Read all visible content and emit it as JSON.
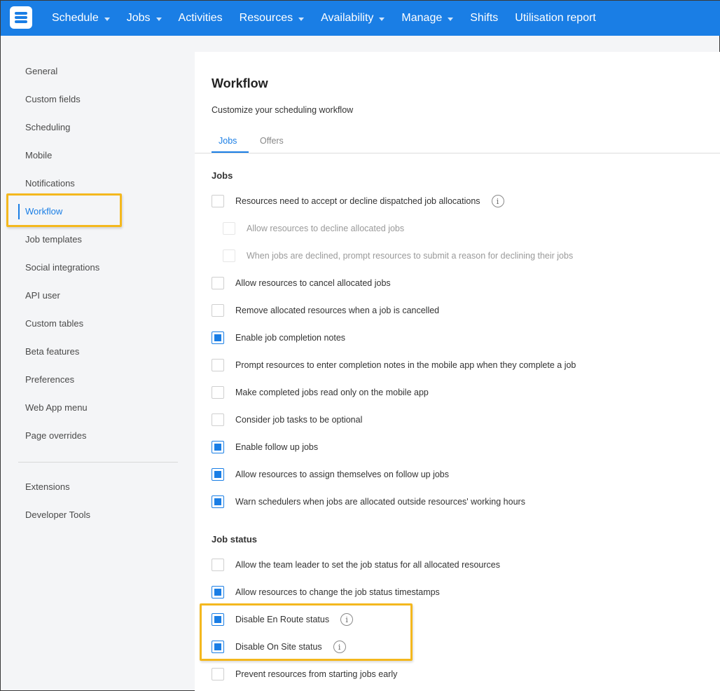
{
  "nav": {
    "items": [
      {
        "label": "Schedule",
        "dropdown": true
      },
      {
        "label": "Jobs",
        "dropdown": true
      },
      {
        "label": "Activities",
        "dropdown": false
      },
      {
        "label": "Resources",
        "dropdown": true
      },
      {
        "label": "Availability",
        "dropdown": true
      },
      {
        "label": "Manage",
        "dropdown": true
      },
      {
        "label": "Shifts",
        "dropdown": false
      },
      {
        "label": "Utilisation report",
        "dropdown": false
      }
    ]
  },
  "sidebar": {
    "items": [
      {
        "label": "General"
      },
      {
        "label": "Custom fields"
      },
      {
        "label": "Scheduling"
      },
      {
        "label": "Mobile"
      },
      {
        "label": "Notifications"
      },
      {
        "label": "Workflow",
        "active": true
      },
      {
        "label": "Job templates"
      },
      {
        "label": "Social integrations"
      },
      {
        "label": "API user"
      },
      {
        "label": "Custom tables"
      },
      {
        "label": "Beta features"
      },
      {
        "label": "Preferences"
      },
      {
        "label": "Web App menu"
      },
      {
        "label": "Page overrides"
      }
    ],
    "secondary": [
      {
        "label": "Extensions"
      },
      {
        "label": "Developer Tools"
      }
    ]
  },
  "main": {
    "title": "Workflow",
    "subtitle": "Customize your scheduling workflow",
    "tabs": [
      {
        "label": "Jobs",
        "active": true
      },
      {
        "label": "Offers",
        "active": false
      }
    ],
    "jobs_section": "Jobs",
    "jobs_options": [
      {
        "label": "Resources need to accept or decline dispatched job allocations",
        "checked": false,
        "info": true
      },
      {
        "label": "Allow resources to decline allocated jobs",
        "checked": false,
        "disabled": true
      },
      {
        "label": "When jobs are declined, prompt resources to submit a reason for declining their jobs",
        "checked": false,
        "disabled": true
      },
      {
        "label": "Allow resources to cancel allocated jobs",
        "checked": false
      },
      {
        "label": "Remove allocated resources when a job is cancelled",
        "checked": false
      },
      {
        "label": "Enable job completion notes",
        "checked": true
      },
      {
        "label": "Prompt resources to enter completion notes in the mobile app when they complete a job",
        "checked": false
      },
      {
        "label": "Make completed jobs read only on the mobile app",
        "checked": false
      },
      {
        "label": "Consider job tasks to be optional",
        "checked": false
      },
      {
        "label": "Enable follow up jobs",
        "checked": true
      },
      {
        "label": "Allow resources to assign themselves on follow up jobs",
        "checked": true
      },
      {
        "label": "Warn schedulers when jobs are allocated outside resources' working hours",
        "checked": true
      }
    ],
    "status_section": "Job status",
    "status_options": [
      {
        "label": "Allow the team leader to set the job status for all allocated resources",
        "checked": false
      },
      {
        "label": "Allow resources to change the job status timestamps",
        "checked": true
      },
      {
        "label": "Disable En Route status",
        "checked": true,
        "info": true
      },
      {
        "label": "Disable On Site status",
        "checked": true,
        "info": true
      },
      {
        "label": "Prevent resources from starting jobs early",
        "checked": false
      }
    ]
  },
  "colors": {
    "brand_blue": "#1a7ee5",
    "highlight": "#f4b81e"
  },
  "icons": {
    "info": "info-icon",
    "caret": "caret-down-icon"
  }
}
